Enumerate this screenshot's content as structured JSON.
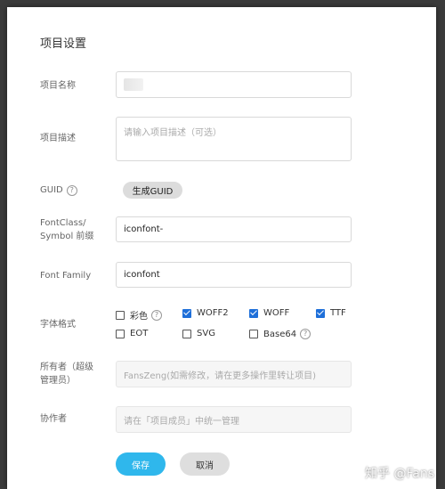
{
  "dialog": {
    "title": "项目设置"
  },
  "fields": {
    "name_label": "项目名称",
    "desc_label": "项目描述",
    "desc_placeholder": "请输入项目描述（可选）",
    "guid_label": "GUID",
    "guid_button": "生成GUID",
    "fontclass_label_line1": "FontClass/",
    "fontclass_label_line2": "Symbol 前缀",
    "fontclass_value": "iconfont-",
    "fontfamily_label": "Font Family",
    "fontfamily_value": "iconfont",
    "format_label": "字体格式",
    "owner_label_line1": "所有者（超级",
    "owner_label_line2": "管理员）",
    "owner_value": "FansZeng(如需修改，请在更多操作里转让项目)",
    "collab_label": "协作者",
    "collab_value": "请在「项目成员」中统一管理"
  },
  "formats": [
    {
      "label": "彩色",
      "checked": false,
      "help": true
    },
    {
      "label": "WOFF2",
      "checked": true,
      "help": false
    },
    {
      "label": "WOFF",
      "checked": true,
      "help": false
    },
    {
      "label": "TTF",
      "checked": true,
      "help": false
    },
    {
      "label": "EOT",
      "checked": false,
      "help": false
    },
    {
      "label": "SVG",
      "checked": false,
      "help": false
    },
    {
      "label": "Base64",
      "checked": false,
      "help": true
    }
  ],
  "help_glyph": "?",
  "actions": {
    "save": "保存",
    "cancel": "取消"
  },
  "watermark": "知乎 @Fans",
  "colors": {
    "primary": "#2fb7ec",
    "checkbox": "#1e6fd9"
  }
}
